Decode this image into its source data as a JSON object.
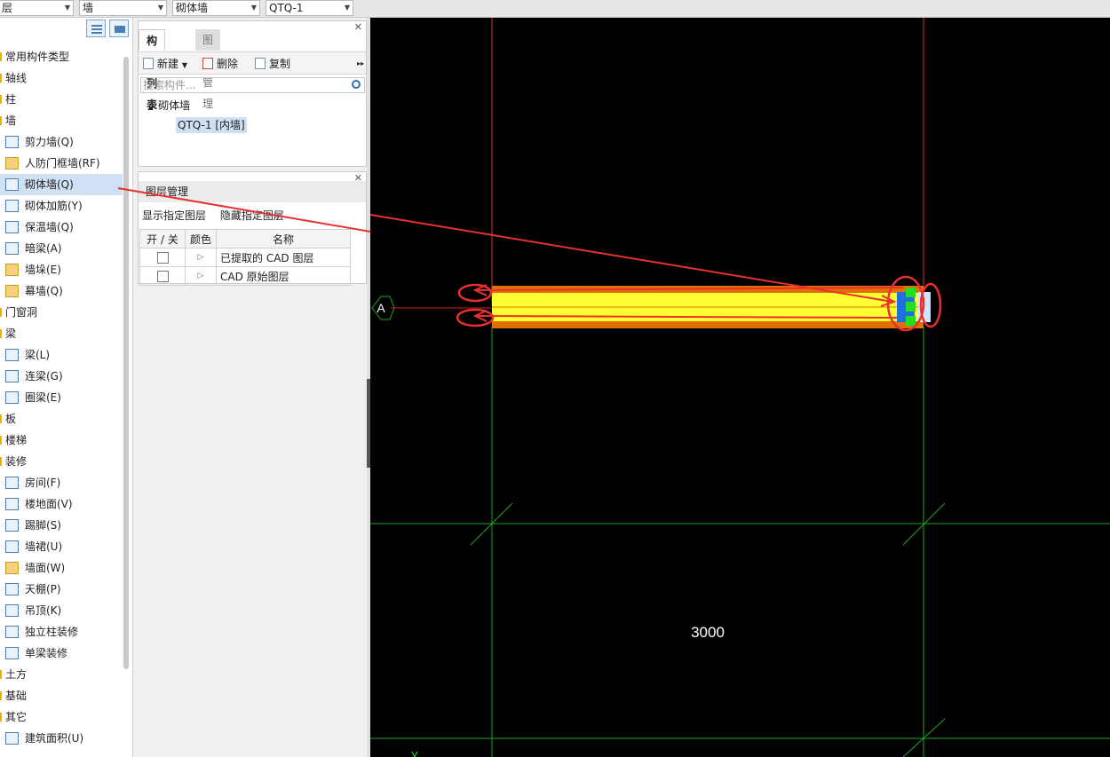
{
  "toolbar": {
    "dropdowns": [
      {
        "value": "层"
      },
      {
        "value": "墙"
      },
      {
        "value": "砌体墙"
      },
      {
        "value": "QTQ-1"
      }
    ]
  },
  "nav_tree": [
    {
      "label": "常用构件类型",
      "kind": "cat"
    },
    {
      "label": "轴线",
      "kind": "cat"
    },
    {
      "label": "柱",
      "kind": "cat"
    },
    {
      "label": "墙",
      "kind": "cat"
    },
    {
      "label": "剪力墙(Q)",
      "kind": "sub",
      "icon": "shear-wall-icon"
    },
    {
      "label": "人防门框墙(RF)",
      "kind": "sub",
      "icon": "civil-defense-door-frame-wall-icon"
    },
    {
      "label": "砌体墙(Q)",
      "kind": "sub",
      "icon": "masonry-wall-icon",
      "selected": true
    },
    {
      "label": "砌体加筋(Y)",
      "kind": "sub",
      "icon": "masonry-reinforcement-icon"
    },
    {
      "label": "保温墙(Q)",
      "kind": "sub",
      "icon": "insulation-wall-icon"
    },
    {
      "label": "暗梁(A)",
      "kind": "sub",
      "icon": "hidden-beam-icon"
    },
    {
      "label": "墙垛(E)",
      "kind": "sub",
      "icon": "wall-buttress-icon"
    },
    {
      "label": "幕墙(Q)",
      "kind": "sub",
      "icon": "curtain-wall-icon"
    },
    {
      "label": "门窗洞",
      "kind": "cat"
    },
    {
      "label": "梁",
      "kind": "cat"
    },
    {
      "label": "梁(L)",
      "kind": "sub",
      "icon": "beam-icon"
    },
    {
      "label": "连梁(G)",
      "kind": "sub",
      "icon": "coupling-beam-icon"
    },
    {
      "label": "圈梁(E)",
      "kind": "sub",
      "icon": "ring-beam-icon"
    },
    {
      "label": "板",
      "kind": "cat"
    },
    {
      "label": "楼梯",
      "kind": "cat"
    },
    {
      "label": "装修",
      "kind": "cat"
    },
    {
      "label": "房间(F)",
      "kind": "sub",
      "icon": "room-icon"
    },
    {
      "label": "楼地面(V)",
      "kind": "sub",
      "icon": "floor-surface-icon"
    },
    {
      "label": "踢脚(S)",
      "kind": "sub",
      "icon": "skirting-icon"
    },
    {
      "label": "墙裙(U)",
      "kind": "sub",
      "icon": "dado-icon"
    },
    {
      "label": "墙面(W)",
      "kind": "sub",
      "icon": "wall-surface-icon"
    },
    {
      "label": "天棚(P)",
      "kind": "sub",
      "icon": "ceiling-icon"
    },
    {
      "label": "吊顶(K)",
      "kind": "sub",
      "icon": "suspended-ceiling-icon"
    },
    {
      "label": "独立柱装修",
      "kind": "sub",
      "icon": "column-finish-icon"
    },
    {
      "label": "单梁装修",
      "kind": "sub",
      "icon": "beam-finish-icon"
    },
    {
      "label": "土方",
      "kind": "cat"
    },
    {
      "label": "基础",
      "kind": "cat"
    },
    {
      "label": "其它",
      "kind": "cat"
    },
    {
      "label": "建筑面积(U)",
      "kind": "sub",
      "icon": "building-area-icon"
    }
  ],
  "component_panel": {
    "tabs": [
      "构件列表",
      "图纸管理"
    ],
    "actions": {
      "new": "新建",
      "delete": "删除",
      "copy": "复制"
    },
    "search_placeholder": "搜索构件...",
    "tree_parent": "砌体墙",
    "tree_child": "QTQ-1 [内墙]"
  },
  "layer_panel": {
    "title": "图层管理",
    "show_btn": "显示指定图层",
    "hide_btn": "隐藏指定图层",
    "headers": [
      "开 / 关",
      "颜色",
      "名称"
    ],
    "rows": [
      {
        "name": "已提取的 CAD 图层"
      },
      {
        "name": "CAD 原始图层"
      }
    ]
  },
  "canvas": {
    "axis_label": "A",
    "dimension": "3000",
    "y_axis_label": "Y",
    "colors": {
      "background": "#000000",
      "grid_green": "#1fa51f",
      "grid_red": "#e03030",
      "wall_fill": "#ffff33",
      "wall_border": "#e07000",
      "annotation_red": "#e83030"
    }
  }
}
